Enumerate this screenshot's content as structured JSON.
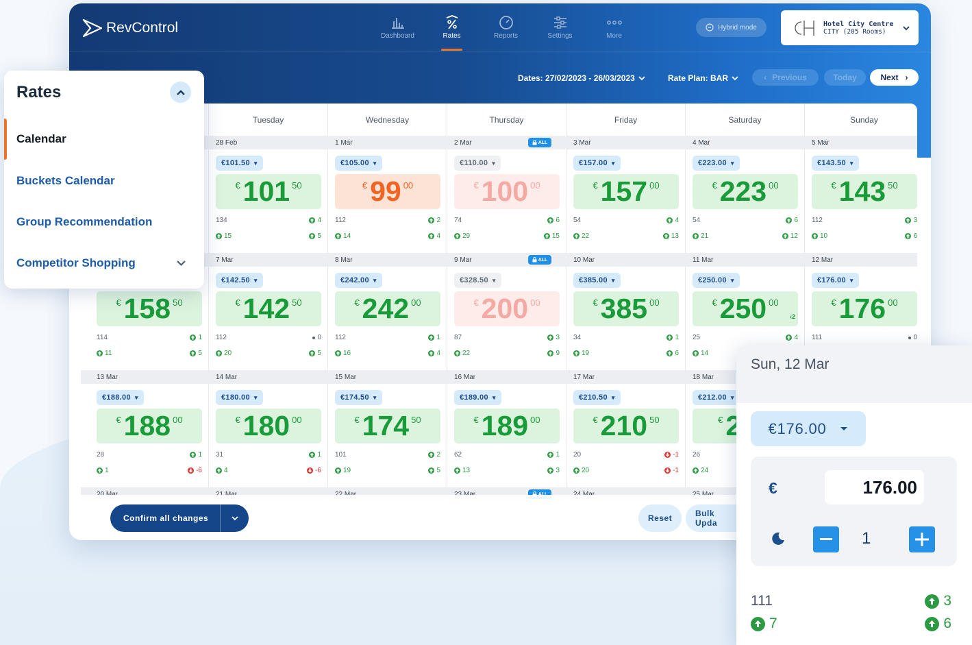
{
  "app": {
    "name": "RevControl"
  },
  "nav": [
    {
      "label": "Dashboard",
      "icon": "bar-chart-icon",
      "active": false
    },
    {
      "label": "Rates",
      "icon": "percent-icon",
      "active": true
    },
    {
      "label": "Reports",
      "icon": "gauge-icon",
      "active": false
    },
    {
      "label": "Settings",
      "icon": "sliders-icon",
      "active": false
    },
    {
      "label": "More",
      "icon": "more-dots-icon",
      "active": false
    }
  ],
  "hybrid_label": "Hybrid mode",
  "hotel": {
    "name": "Hotel City Centre",
    "sub": "CITY (205 Rooms)"
  },
  "toolbar": {
    "dates": "Dates: 27/02/2023 - 26/03/2023",
    "rate_plan": "Rate Plan: BAR",
    "previous": "Previous",
    "today": "Today",
    "next": "Next"
  },
  "days": [
    "Tuesday",
    "Wednesday",
    "Thursday",
    "Friday",
    "Saturday",
    "Sunday"
  ],
  "weeks": [
    {
      "cells": [
        {
          "date": "28 Feb",
          "sel": "€101.50",
          "int": "101",
          "dec": "50",
          "color": "green",
          "a": "134",
          "b": "4",
          "c": "15",
          "d": "5",
          "bdir": "up",
          "ddir": "up",
          "lock": false,
          "selgrey": false
        },
        {
          "date": "1 Mar",
          "sel": "€105.00",
          "int": "99",
          "dec": "00",
          "color": "orange",
          "a": "112",
          "b": "2",
          "c": "14",
          "d": "4",
          "bdir": "up",
          "ddir": "up",
          "lock": false,
          "selgrey": false
        },
        {
          "date": "2 Mar",
          "sel": "€110.00",
          "int": "100",
          "dec": "00",
          "color": "pink",
          "a": "74",
          "b": "6",
          "c": "29",
          "d": "15",
          "bdir": "up",
          "ddir": "up",
          "lock": true,
          "selgrey": true
        },
        {
          "date": "3 Mar",
          "sel": "€157.00",
          "int": "157",
          "dec": "00",
          "color": "green",
          "a": "54",
          "b": "4",
          "c": "22",
          "d": "13",
          "bdir": "up",
          "ddir": "up",
          "lock": false,
          "selgrey": false
        },
        {
          "date": "4 Mar",
          "sel": "€223.00",
          "int": "223",
          "dec": "00",
          "color": "green",
          "a": "54",
          "b": "6",
          "c": "21",
          "d": "12",
          "bdir": "up",
          "ddir": "up",
          "lock": false,
          "selgrey": false
        },
        {
          "date": "5 Mar",
          "sel": "€143.50",
          "int": "143",
          "dec": "50",
          "color": "green",
          "a": "112",
          "b": "3",
          "c": "10",
          "d": "6",
          "bdir": "up",
          "ddir": "up",
          "lock": false,
          "selgrey": false
        }
      ]
    },
    {
      "cells": [
        {
          "date": "7 Mar",
          "sel": "€142.50",
          "int": "142",
          "dec": "50",
          "color": "green",
          "a": "112",
          "b": "0",
          "c": "20",
          "d": "5",
          "bdir": "neu",
          "ddir": "up",
          "lock": false,
          "selgrey": false
        },
        {
          "date": "8 Mar",
          "sel": "€242.00",
          "int": "242",
          "dec": "00",
          "color": "green",
          "a": "112",
          "b": "1",
          "c": "16",
          "d": "4",
          "bdir": "up",
          "ddir": "up",
          "lock": false,
          "selgrey": false
        },
        {
          "date": "9 Mar",
          "sel": "€328.50",
          "int": "200",
          "dec": "00",
          "color": "pink",
          "a": "87",
          "b": "3",
          "c": "22",
          "d": "9",
          "bdir": "up",
          "ddir": "up",
          "lock": true,
          "selgrey": true
        },
        {
          "date": "10 Mar",
          "sel": "€385.00",
          "int": "385",
          "dec": "00",
          "color": "green",
          "a": "34",
          "b": "1",
          "c": "19",
          "d": "6",
          "bdir": "up",
          "ddir": "up",
          "lock": false,
          "selgrey": false
        },
        {
          "date": "11 Mar",
          "sel": "€250.00",
          "int": "250",
          "dec": "00",
          "color": "green",
          "a": "25",
          "b": "4",
          "c": "14",
          "d": "",
          "bdir": "up",
          "ddir": "none",
          "lock": false,
          "selgrey": false,
          "extra": "2"
        },
        {
          "date": "12 Mar",
          "sel": "€176.00",
          "int": "176",
          "dec": "00",
          "color": "green",
          "a": "111",
          "b": "0",
          "c": "",
          "d": "",
          "bdir": "neu",
          "ddir": "none",
          "lock": false,
          "selgrey": false
        }
      ]
    },
    {
      "cells": [
        {
          "date": "14 Mar",
          "sel": "€180.00",
          "int": "180",
          "dec": "00",
          "color": "green",
          "a": "31",
          "b": "1",
          "c": "4",
          "d": "-6",
          "bdir": "up",
          "ddir": "dn",
          "lock": false,
          "selgrey": false
        },
        {
          "date": "15 Mar",
          "sel": "€174.50",
          "int": "174",
          "dec": "50",
          "color": "green",
          "a": "101",
          "b": "2",
          "c": "19",
          "d": "5",
          "bdir": "up",
          "ddir": "up",
          "lock": false,
          "selgrey": false
        },
        {
          "date": "16 Mar",
          "sel": "€189.00",
          "int": "189",
          "dec": "00",
          "color": "green",
          "a": "62",
          "b": "1",
          "c": "13",
          "d": "3",
          "bdir": "up",
          "ddir": "up",
          "lock": false,
          "selgrey": false
        },
        {
          "date": "17 Mar",
          "sel": "€210.50",
          "int": "210",
          "dec": "50",
          "color": "green",
          "a": "20",
          "b": "-1",
          "c": "20",
          "d": "-1",
          "bdir": "dn",
          "ddir": "dn",
          "lock": false,
          "selgrey": false
        },
        {
          "date": "18 Mar",
          "sel": "€212.00",
          "int": "212",
          "dec": "",
          "color": "green",
          "a": "26",
          "b": "",
          "c": "24",
          "d": "",
          "bdir": "none",
          "ddir": "none",
          "lock": false,
          "selgrey": false
        }
      ]
    }
  ],
  "monday_cells": [
    {
      "date": "",
      "sel": "",
      "int": "158",
      "dec": "50",
      "a": "114",
      "b": "1",
      "c": "11",
      "d": "5",
      "bdir": "up",
      "ddir": "up"
    },
    {
      "date": "13 Mar",
      "sel": "€188.00",
      "int": "188",
      "dec": "00",
      "a": "28",
      "b": "1",
      "c": "1",
      "d": "-6",
      "bdir": "up",
      "ddir": "dn"
    }
  ],
  "last_row_dates": [
    "20 Mar",
    "21 Mar",
    "22 Mar",
    "23 Mar",
    "24 Mar",
    "25 Mar"
  ],
  "last_row_lock_label": "ALL",
  "lock_label": "ALL",
  "bottom": {
    "confirm": "Confirm all changes",
    "reset": "Reset",
    "bulk": "Bulk Upda"
  },
  "rates_panel": {
    "title": "Rates",
    "items": [
      "Calendar",
      "Buckets Calendar",
      "Group Recommendation",
      "Competitor Shopping"
    ]
  },
  "detail": {
    "title": "Sun, 12 Mar",
    "select": "€176.00",
    "currency": "€",
    "value": "176.00",
    "nights": "1",
    "f1": "111",
    "f2": "7",
    "f3": "3",
    "f4": "6"
  },
  "colors": {
    "accent": "#e9752c",
    "green": "#1a9b3a",
    "orange": "#f06424",
    "navy": "#15468a",
    "blue": "#2592e8"
  }
}
